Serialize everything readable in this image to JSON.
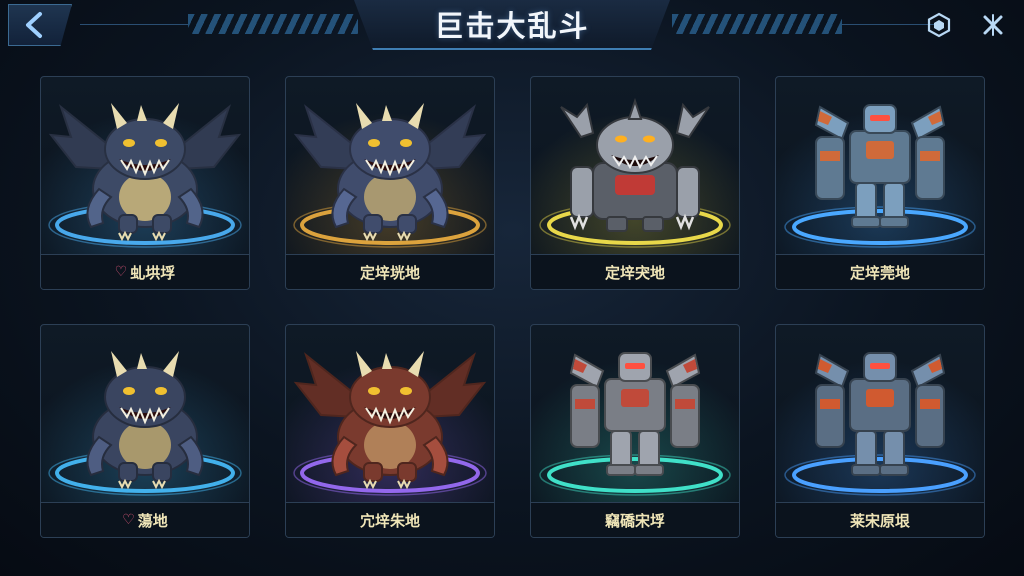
{
  "header": {
    "title": "巨击大乱斗",
    "back_icon": "chevron-left-icon",
    "right_icons": [
      "hexagon-settings-icon",
      "close-cross-icon"
    ]
  },
  "monsters": [
    {
      "label": "♡虬垬垺",
      "kind": "dragon",
      "body": "#3d4a66",
      "belly": "#b8a878",
      "ring": "#4fb7ff",
      "wings": true
    },
    {
      "label": "定垶垙地",
      "kind": "dragon",
      "body": "#404c6c",
      "belly": "#a89870",
      "ring": "#f0b040",
      "wings": true
    },
    {
      "label": "定垶宊地",
      "kind": "robot-beast",
      "body": "#5a5f68",
      "accent": "#9aa0aa",
      "ring": "#e8d84a"
    },
    {
      "label": "定垶莞地",
      "kind": "mech",
      "body": "#5f7a92",
      "accent": "#d06a3a",
      "ring": "#4aa8ff"
    },
    {
      "label": "♡蕩地",
      "kind": "dragon",
      "body": "#3a4560",
      "belly": "#a8986c",
      "ring": "#48c0ff",
      "wings": false
    },
    {
      "label": "宂垶朱地",
      "kind": "dragon",
      "body": "#7a3a2e",
      "belly": "#b08058",
      "ring": "#a070ff",
      "wings": true
    },
    {
      "label": "竊礄宋垺",
      "kind": "mech",
      "body": "#7a7e86",
      "accent": "#c04a3a",
      "ring": "#40e0c8"
    },
    {
      "label": "莱宋原垠",
      "kind": "mech",
      "body": "#5a6e84",
      "accent": "#d05a30",
      "ring": "#4aa0ff"
    }
  ]
}
